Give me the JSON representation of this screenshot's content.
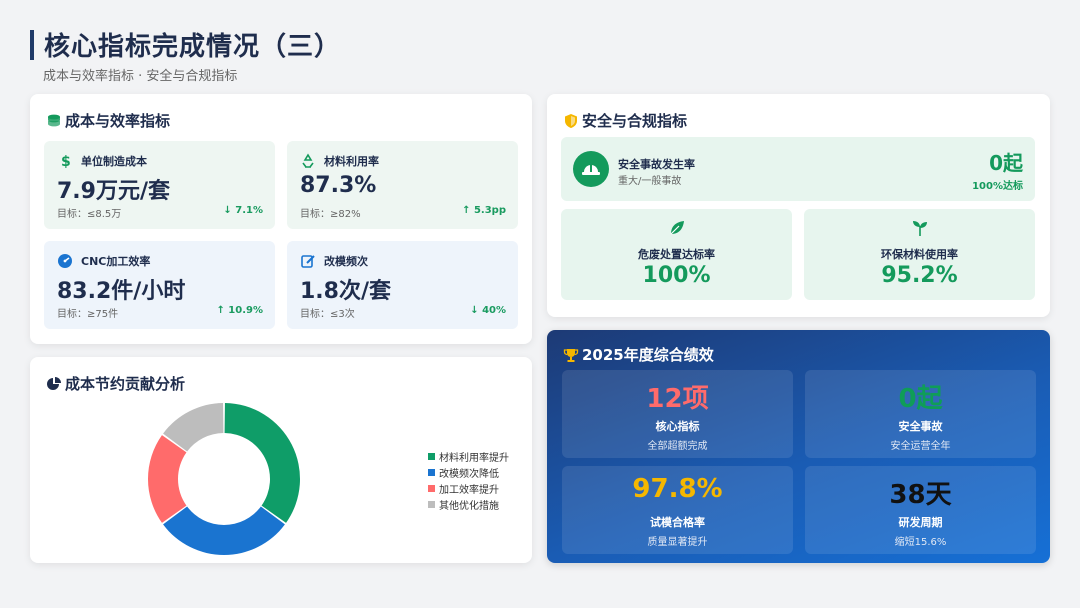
{
  "header": {
    "title": "核心指标完成情况（三）",
    "subtitle": "成本与效率指标 · 安全与合规指标"
  },
  "cost_card": {
    "title": "成本与效率指标",
    "metrics": [
      {
        "label": "单位制造成本",
        "value": "7.9万元/套",
        "target": "目标：≤8.5万",
        "change": "↓ 7.1%",
        "icon": "dollar-icon"
      },
      {
        "label": "材料利用率",
        "value": "87.3%",
        "target": "目标：≥82%",
        "change": "↑ 5.3pp",
        "icon": "recycle-icon"
      },
      {
        "label": "CNC加工效率",
        "value": "83.2件/小时",
        "target": "目标：≥75件",
        "change": "↑ 10.9%",
        "icon": "gauge-icon"
      },
      {
        "label": "改模频次",
        "value": "1.8次/套",
        "target": "目标：≤3次",
        "change": "↓ 40%",
        "icon": "edit-icon"
      }
    ]
  },
  "safety_card": {
    "title": "安全与合规指标",
    "incident": {
      "label": "安全事故发生率",
      "sub": "重大/一般事故",
      "value": "0起",
      "note": "100%达标"
    },
    "tiles": [
      {
        "label": "危废处置达标率",
        "value": "100%",
        "icon": "leaf-icon"
      },
      {
        "label": "环保材料使用率",
        "value": "95.2%",
        "icon": "seedling-icon"
      }
    ]
  },
  "savings_card": {
    "title": "成本节约贡献分析"
  },
  "performance_card": {
    "title": "2025年度综合绩效",
    "tiles": [
      {
        "value": "12项",
        "label": "核心指标",
        "sub": "全部超额完成",
        "color": "#ff6b6b"
      },
      {
        "value": "0起",
        "label": "安全事故",
        "sub": "安全运营全年",
        "color": "#0f9d58"
      },
      {
        "value": "97.8%",
        "label": "试模合格率",
        "sub": "质量显著提升",
        "color": "#f5b700"
      },
      {
        "value": "38天",
        "label": "研发周期",
        "sub": "缩短15.6%",
        "color": "#111111"
      }
    ]
  },
  "colors": {
    "navy": "#1f2d4d",
    "green": "#149a5c",
    "donut_green": "#0f9d68",
    "donut_blue": "#1a74d0",
    "donut_red": "#ff6b6b",
    "donut_gray": "#bdbdbd"
  },
  "chart_data": {
    "type": "pie",
    "donut": true,
    "categories": [
      "材料利用率提升",
      "改模频次降低",
      "加工效率提升",
      "其他优化措施"
    ],
    "values": [
      35,
      30,
      20,
      15
    ],
    "colors": [
      "#0f9d68",
      "#1a74d0",
      "#ff6b6b",
      "#bdbdbd"
    ],
    "legend": "right"
  }
}
